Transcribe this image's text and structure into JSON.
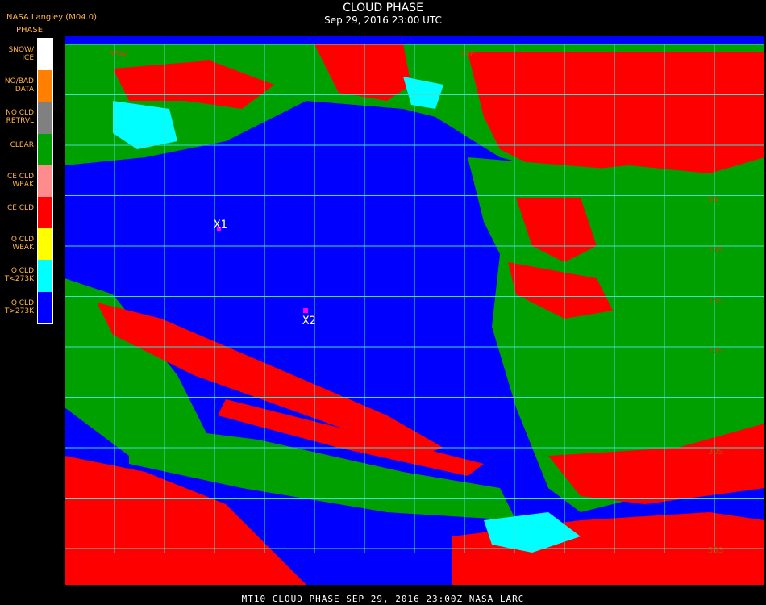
{
  "header": {
    "org": "NASA Langley (M04.0)",
    "phase_label": "PHASE",
    "title": "CLOUD PHASE",
    "subtitle": "Sep 29, 2016 23:00 UTC"
  },
  "legend": [
    {
      "l1": "SNOW/",
      "l2": "ICE",
      "color": "#ffffff"
    },
    {
      "l1": "NO/BAD",
      "l2": "DATA",
      "color": "#ff8000"
    },
    {
      "l1": "NO CLD",
      "l2": "RETRVL",
      "color": "#808080"
    },
    {
      "l1": "",
      "l2": "CLEAR",
      "color": "#00a000"
    },
    {
      "l1": "CE CLD",
      "l2": "WEAK",
      "color": "#ff8c8c"
    },
    {
      "l1": "",
      "l2": "CE CLD",
      "color": "#ff0000"
    },
    {
      "l1": "IQ CLD",
      "l2": "WEAK",
      "color": "#ffff00"
    },
    {
      "l1": "IQ CLD",
      "l2": "T<273K",
      "color": "#00ffff"
    },
    {
      "l1": "IQ CLD",
      "l2": "T>273K",
      "color": "#0000ff"
    }
  ],
  "map": {
    "markers": [
      {
        "label": "X1"
      },
      {
        "label": "X2"
      }
    ],
    "lat_labels": [
      "5S",
      "10S",
      "15S",
      "20S",
      "30S",
      "35S"
    ],
    "lon_labels": [
      "35W",
      "10E"
    ]
  },
  "footer": "MT10  CLOUD PHASE   SEP 29, 2016 23:00Z   NASA LARC"
}
